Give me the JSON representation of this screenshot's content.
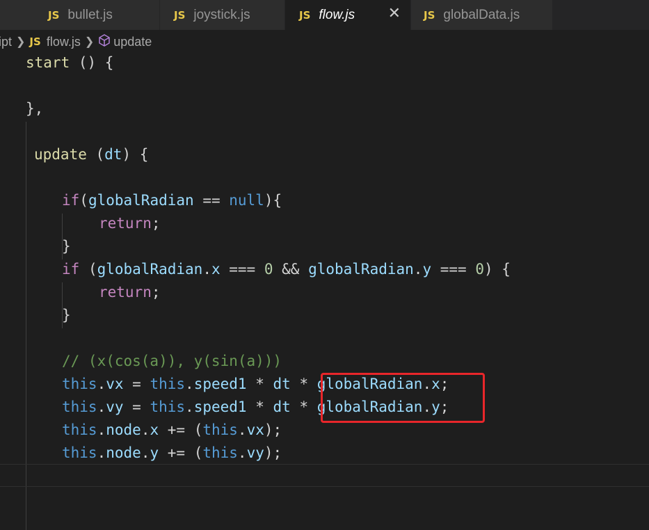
{
  "tabs": [
    {
      "icon": "JS",
      "label": "bullet.js"
    },
    {
      "icon": "JS",
      "label": "joystick.js"
    },
    {
      "icon": "JS",
      "label": "flow.js",
      "close": "✕"
    },
    {
      "icon": "JS",
      "label": "globalData.js"
    }
  ],
  "breadcrumb": {
    "folder": "ipt",
    "file_icon": "JS",
    "file": "flow.js",
    "symbol": "update"
  },
  "code": {
    "l1": {
      "name": "start",
      "rest": " () {"
    },
    "l3": "},",
    "l5": {
      "name": "update",
      "rest1": " (",
      "param": "dt",
      "rest2": ") {"
    },
    "l7": {
      "kw": "if",
      "p1": "(",
      "v": "globalRadian",
      "op": " == ",
      "lit": "null",
      "p2": "){"
    },
    "l8": {
      "kw": "return",
      "p": ";"
    },
    "l9": "}",
    "l10": {
      "kw": "if",
      "p1": " (",
      "v1": "globalRadian",
      "d1": ".",
      "x": "x",
      "op1": " === ",
      "n1": "0",
      "and": " && ",
      "v2": "globalRadian",
      "d2": ".",
      "y": "y",
      "op2": " === ",
      "n2": "0",
      "p2": ") {"
    },
    "l11": {
      "kw": "return",
      "p": ";"
    },
    "l12": "}",
    "l14": "// (x(cos(a)), y(sin(a)))",
    "l15": {
      "this1": "this",
      "d": ".",
      "vx": "vx",
      "eq": " = ",
      "this2": "this",
      "d2": ".",
      "sp": "speed1",
      "m1": " * ",
      "dt": "dt",
      "m2": " * ",
      "gr": "globalRadian",
      "d3": ".",
      "x": "x",
      "end": ";"
    },
    "l16": {
      "this1": "this",
      "d": ".",
      "vy": "vy",
      "eq": " = ",
      "this2": "this",
      "d2": ".",
      "sp": "speed1",
      "m1": " * ",
      "dt": "dt",
      "m2": " * ",
      "gr": "globalRadian",
      "d3": ".",
      "y": "y",
      "end": ";"
    },
    "l17": {
      "this1": "this",
      "d": ".",
      "node": "node",
      "d2": ".",
      "x": "x",
      "op": " += (",
      "this2": "this",
      "d3": ".",
      "vx": "vx",
      "end": ");"
    },
    "l18": {
      "this1": "this",
      "d": ".",
      "node": "node",
      "d2": ".",
      "y": "y",
      "op": " += (",
      "this2": "this",
      "d3": ".",
      "vy": "vy",
      "end": ");"
    }
  },
  "colors": {
    "accent_js": "#e8c84a",
    "highlight_box": "#e8262a",
    "background": "#1e1e1e"
  }
}
